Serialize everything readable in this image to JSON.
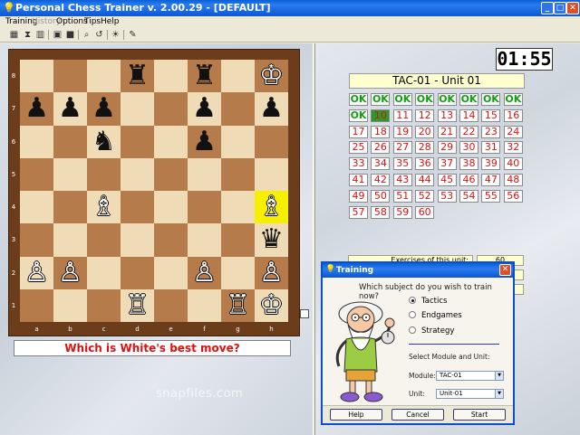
{
  "window": {
    "title": "Personal Chess Trainer v. 2.00.29 - [DEFAULT]",
    "icon": "bulb-icon",
    "controls": [
      "minimize",
      "maximize",
      "close"
    ]
  },
  "menu": {
    "items": [
      {
        "label": "Training",
        "enabled": true
      },
      {
        "label": "History",
        "enabled": false
      },
      {
        "label": "Options",
        "enabled": true
      },
      {
        "label": "Tips",
        "enabled": true
      },
      {
        "label": "Help",
        "enabled": true
      }
    ]
  },
  "toolbar": {
    "icons": [
      "grid-icon",
      "hourglass-icon",
      "stats-icon",
      "window-icon",
      "save-icon",
      "search-icon",
      "reset-icon",
      "bulb-icon",
      "edit-icon"
    ]
  },
  "board": {
    "ranks": [
      "8",
      "7",
      "6",
      "5",
      "4",
      "3",
      "2",
      "1"
    ],
    "files": [
      "a",
      "b",
      "c",
      "d",
      "e",
      "f",
      "g",
      "h"
    ],
    "highlight_square": "h4",
    "colors": {
      "light": "#efdcb6",
      "dark": "#b57b4b",
      "frame": "#6b3d1b",
      "highlight": "#f6f000"
    },
    "pieces": [
      {
        "square": "d8",
        "color": "black",
        "type": "rook",
        "glyph": "♜"
      },
      {
        "square": "f8",
        "color": "black",
        "type": "rook",
        "glyph": "♜"
      },
      {
        "square": "h8",
        "color": "white",
        "type": "king",
        "glyph": "♔"
      },
      {
        "square": "a7",
        "color": "black",
        "type": "pawn",
        "glyph": "♟"
      },
      {
        "square": "b7",
        "color": "black",
        "type": "pawn",
        "glyph": "♟"
      },
      {
        "square": "c7",
        "color": "black",
        "type": "pawn",
        "glyph": "♟"
      },
      {
        "square": "f7",
        "color": "black",
        "type": "pawn",
        "glyph": "♟"
      },
      {
        "square": "h7",
        "color": "black",
        "type": "pawn",
        "glyph": "♟"
      },
      {
        "square": "c6",
        "color": "black",
        "type": "knight",
        "glyph": "♞"
      },
      {
        "square": "f6",
        "color": "black",
        "type": "pawn",
        "glyph": "♟"
      },
      {
        "square": "c4",
        "color": "white",
        "type": "bishop",
        "glyph": "♗"
      },
      {
        "square": "h4",
        "color": "white",
        "type": "bishop",
        "glyph": "♗"
      },
      {
        "square": "h3",
        "color": "black",
        "type": "queen",
        "glyph": "♛"
      },
      {
        "square": "a2",
        "color": "white",
        "type": "pawn",
        "glyph": "♙"
      },
      {
        "square": "b2",
        "color": "white",
        "type": "pawn",
        "glyph": "♙"
      },
      {
        "square": "f2",
        "color": "white",
        "type": "pawn",
        "glyph": "♙"
      },
      {
        "square": "h2",
        "color": "white",
        "type": "pawn",
        "glyph": "♙"
      },
      {
        "square": "d1",
        "color": "white",
        "type": "rook",
        "glyph": "♖"
      },
      {
        "square": "g1",
        "color": "white",
        "type": "rook",
        "glyph": "♖"
      },
      {
        "square": "h1",
        "color": "white",
        "type": "king",
        "glyph": "♔"
      }
    ]
  },
  "question": "Which is White's best move?",
  "watermark": "snapfiles.com",
  "timer": "01:55",
  "unit": {
    "title": "TAC-01  -  Unit 01",
    "exercises": [
      {
        "label": "OK",
        "status": "ok"
      },
      {
        "label": "OK",
        "status": "ok"
      },
      {
        "label": "OK",
        "status": "ok"
      },
      {
        "label": "OK",
        "status": "ok"
      },
      {
        "label": "OK",
        "status": "ok"
      },
      {
        "label": "OK",
        "status": "ok"
      },
      {
        "label": "OK",
        "status": "ok"
      },
      {
        "label": "OK",
        "status": "ok"
      },
      {
        "label": "OK",
        "status": "ok"
      },
      {
        "label": "10",
        "status": "current"
      },
      {
        "label": "11",
        "status": "todo"
      },
      {
        "label": "12",
        "status": "todo"
      },
      {
        "label": "13",
        "status": "todo"
      },
      {
        "label": "14",
        "status": "todo"
      },
      {
        "label": "15",
        "status": "todo"
      },
      {
        "label": "16",
        "status": "todo"
      },
      {
        "label": "17",
        "status": "todo"
      },
      {
        "label": "18",
        "status": "todo"
      },
      {
        "label": "19",
        "status": "todo"
      },
      {
        "label": "20",
        "status": "todo"
      },
      {
        "label": "21",
        "status": "todo"
      },
      {
        "label": "22",
        "status": "todo"
      },
      {
        "label": "23",
        "status": "todo"
      },
      {
        "label": "24",
        "status": "todo"
      },
      {
        "label": "25",
        "status": "todo"
      },
      {
        "label": "26",
        "status": "todo"
      },
      {
        "label": "27",
        "status": "todo"
      },
      {
        "label": "28",
        "status": "todo"
      },
      {
        "label": "29",
        "status": "todo"
      },
      {
        "label": "30",
        "status": "todo"
      },
      {
        "label": "31",
        "status": "todo"
      },
      {
        "label": "32",
        "status": "todo"
      },
      {
        "label": "33",
        "status": "todo"
      },
      {
        "label": "34",
        "status": "todo"
      },
      {
        "label": "35",
        "status": "todo"
      },
      {
        "label": "36",
        "status": "todo"
      },
      {
        "label": "37",
        "status": "todo"
      },
      {
        "label": "38",
        "status": "todo"
      },
      {
        "label": "39",
        "status": "todo"
      },
      {
        "label": "40",
        "status": "todo"
      },
      {
        "label": "41",
        "status": "todo"
      },
      {
        "label": "42",
        "status": "todo"
      },
      {
        "label": "43",
        "status": "todo"
      },
      {
        "label": "44",
        "status": "todo"
      },
      {
        "label": "45",
        "status": "todo"
      },
      {
        "label": "46",
        "status": "todo"
      },
      {
        "label": "47",
        "status": "todo"
      },
      {
        "label": "48",
        "status": "todo"
      },
      {
        "label": "49",
        "status": "todo"
      },
      {
        "label": "50",
        "status": "todo"
      },
      {
        "label": "51",
        "status": "todo"
      },
      {
        "label": "52",
        "status": "todo"
      },
      {
        "label": "53",
        "status": "todo"
      },
      {
        "label": "54",
        "status": "todo"
      },
      {
        "label": "55",
        "status": "todo"
      },
      {
        "label": "56",
        "status": "todo"
      },
      {
        "label": "57",
        "status": "todo"
      },
      {
        "label": "58",
        "status": "todo"
      },
      {
        "label": "59",
        "status": "todo"
      },
      {
        "label": "60",
        "status": "todo"
      }
    ],
    "info": {
      "exercises_label": "Exercises of this unit:",
      "exercises_value": "60"
    }
  },
  "dialog": {
    "title": "Training",
    "question": "Which subject do you wish to train now?",
    "options": [
      {
        "label": "Tactics",
        "selected": true
      },
      {
        "label": "Endgames",
        "selected": false
      },
      {
        "label": "Strategy",
        "selected": false
      }
    ],
    "select_heading": "Select Module and Unit:",
    "module_label": "Module:",
    "module_value": "TAC-01",
    "unit_label": "Unit:",
    "unit_value": "Unit-01",
    "buttons": {
      "help": "Help",
      "cancel": "Cancel",
      "start": "Start"
    }
  }
}
